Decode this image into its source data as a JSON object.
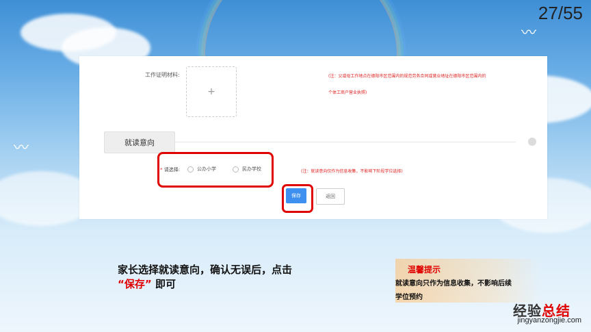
{
  "slide": {
    "page_number": "27/55"
  },
  "form": {
    "work_proof_label": "工作证明材料:",
    "upload_placeholder": "+",
    "work_note_line1": "(注：父或母工作地点在德阳市区范围内的规范劳务合同或营业地址在德阳市区范围内的",
    "work_note_line2": "个体工商户营业执照)",
    "section_title": "就读意向",
    "select_label": "请选择:",
    "required_mark": "*",
    "options": [
      "公办小学",
      "民办学校"
    ],
    "select_note": "(注：就读意向仅作为信息收集，不影响下阶段学位选择)",
    "save_button": "保存",
    "back_button": "返回"
  },
  "instruction": {
    "line1": "家长选择就读意向，确认无误后，点击",
    "quote_open": "“",
    "highlight": "保存",
    "quote_close": "”",
    "tail": "即可"
  },
  "tip": {
    "title": "温馨提示",
    "line1": "就读意向只作为信息收集，不影响后续",
    "line2": "学位预约"
  },
  "watermark": {
    "text_main": "经验",
    "text_accent": "总结",
    "url": "jingyanzongjie.com"
  },
  "colors": {
    "highlight_red": "#e00000",
    "save_blue": "#3d8ff0"
  }
}
